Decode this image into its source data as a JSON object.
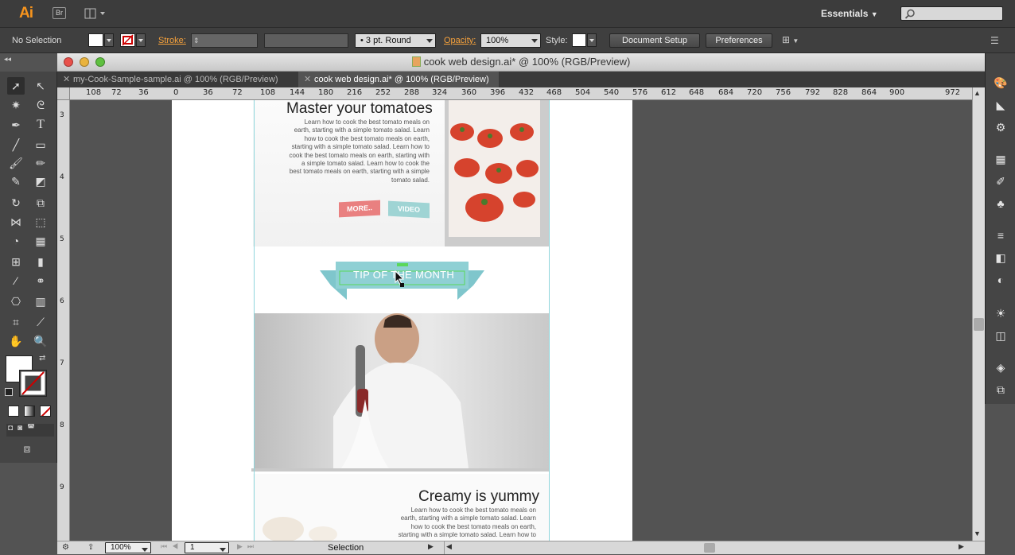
{
  "app": {
    "logo": "Ai",
    "bridge_label": "Br",
    "workspace": "Essentials"
  },
  "control_bar": {
    "selection": "No Selection",
    "stroke_label": "Stroke:",
    "brush_label": "3 pt. Round",
    "opacity_label": "Opacity:",
    "opacity_value": "100%",
    "style_label": "Style:",
    "document_setup": "Document Setup",
    "preferences": "Preferences"
  },
  "window": {
    "title": "cook web design.ai* @ 100% (RGB/Preview)"
  },
  "tabs": [
    {
      "label": "my-Cook-Sample-sample.ai @ 100% (RGB/Preview)"
    },
    {
      "label": "cook web design.ai* @ 100% (RGB/Preview)"
    }
  ],
  "hruler": [
    "108",
    "72",
    "36",
    "0",
    "36",
    "72",
    "108",
    "144",
    "180",
    "216",
    "252",
    "288",
    "324",
    "360",
    "396",
    "432",
    "468",
    "504",
    "540",
    "576",
    "612",
    "648",
    "684",
    "720",
    "756",
    "792",
    "828",
    "864",
    "900",
    "972"
  ],
  "vruler": [
    "3",
    "4",
    "5",
    "6",
    "7",
    "8",
    "9"
  ],
  "artboard": {
    "heading1": "Master your tomatoes",
    "para1": "Learn how to cook the best tomato meals on earth, starting with a simple tomato salad. Learn how to cook the best tomato meals on earth, starting with a simple tomato salad. Learn how to cook the best tomato meals on earth, starting with a simple tomato salad. Learn how to cook the best tomato meals on earth, starting with a simple tomato salad.",
    "more_btn": "MORE..",
    "video_btn": "VIDEO",
    "tip_banner": "TIP OF THE MONTH",
    "heading2": "Creamy is yummy",
    "para2": "Learn how to cook the best tomato meals on earth, starting with a simple tomato salad. Learn how to cook the best tomato meals on earth, starting with a simple tomato salad. Learn how to"
  },
  "status": {
    "zoom": "100%",
    "artboard_no": "1",
    "tool": "Selection"
  },
  "colors": {
    "accent_orange": "#f7941d",
    "guide_cyan": "#8fd6dc",
    "banner_teal": "#7fc6cc",
    "more_pink": "#e98080",
    "video_teal": "#9fd4d4"
  }
}
